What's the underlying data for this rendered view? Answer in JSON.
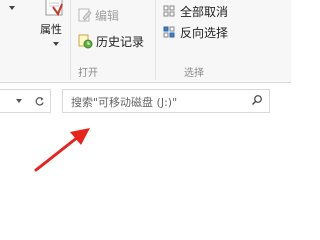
{
  "ribbon": {
    "properties_label": "属性",
    "edit_label": "编辑",
    "history_label": "历史记录",
    "open_group_label": "打开",
    "select_all_none_label": "全部取消",
    "invert_selection_label": "反向选择",
    "select_group_label": "选择"
  },
  "address_bar": {
    "search_placeholder": "搜索\"可移动磁盘 (J:)\""
  },
  "colors": {
    "accent_red": "#e8231b",
    "ribbon_bg": "#f7f7f7",
    "group_label": "#8a8a8a"
  },
  "icons": {
    "properties": "properties-icon",
    "edit": "edit-icon",
    "history": "history-icon",
    "select_none": "select-none-icon",
    "invert_selection": "invert-selection-icon",
    "refresh": "refresh-icon",
    "search": "search-icon"
  }
}
